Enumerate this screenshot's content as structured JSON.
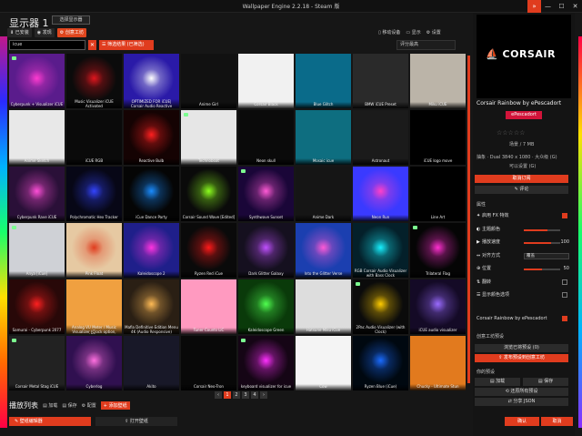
{
  "window": {
    "title": "Wallpaper Engine 2.2.18 - Steam 版"
  },
  "header": {
    "title": "显示器 1",
    "display_select": "选择显示器"
  },
  "tabs": [
    {
      "label": "已安装",
      "icon": "download-icon"
    },
    {
      "label": "发现",
      "icon": "compass-icon"
    },
    {
      "label": "创意工坊",
      "icon": "workshop-icon",
      "active": true
    }
  ],
  "top_right": {
    "mobile": "移动设备",
    "display": "显示",
    "settings": "设置"
  },
  "filter": {
    "search_value": "icue",
    "clear_label": "✕",
    "filter_button": "筛选结果 (已筛选)",
    "sort_value": "评分最高"
  },
  "wallpapers": [
    {
      "title": "Cyberpunk + Visualizer iCUE",
      "bg": "#5a1c8c",
      "fg": "#ff3bd1",
      "badge": true
    },
    {
      "title": "Music Visualizer iCUE Activated",
      "bg": "#0b0b0b",
      "fg": "#e0161e",
      "badge": false
    },
    {
      "title": "OPTIMIZED FOR iCUE| Corsair Audio Reactive",
      "bg": "#2a1aa8",
      "fg": "#ffffff",
      "badge": false
    },
    {
      "title": "Anime Girl",
      "bg": "#111",
      "fg": "#ddd",
      "badge": false
    },
    {
      "title": "Corsair Black",
      "bg": "#f1f1f1",
      "fg": "#000",
      "badge": false
    },
    {
      "title": "Blue Glitch",
      "bg": "#0a6b8a",
      "fg": "#9ff",
      "badge": false
    },
    {
      "title": "BMW iCUE Preset",
      "bg": "#2a2a2a",
      "fg": "#bbb",
      "badge": false
    },
    {
      "title": "Miku iCUE",
      "bg": "#bbb4a8",
      "fg": "#fff",
      "badge": false
    },
    {
      "title": "Anime Sketch",
      "bg": "#e8e8e8",
      "fg": "#333",
      "badge": false
    },
    {
      "title": "iCUE RGB",
      "bg": "#0a0a0a",
      "fg": "#0f0",
      "badge": false
    },
    {
      "title": "Reactive Bulb",
      "bg": "#150303",
      "fg": "#ff2020",
      "badge": false
    },
    {
      "title": "Technoboat",
      "bg": "#e6e6e6",
      "fg": "#222",
      "badge": true
    },
    {
      "title": "Neon skull",
      "bg": "#0a0a0a",
      "fg": "#ddd",
      "badge": false
    },
    {
      "title": "Mosaic icue",
      "bg": "#0e6e80",
      "fg": "#6ff",
      "badge": false
    },
    {
      "title": "Astronaut",
      "bg": "#1b1b1b",
      "fg": "#999",
      "badge": false
    },
    {
      "title": "iCUE logo move",
      "bg": "#000",
      "fg": "#fff",
      "badge": false
    },
    {
      "title": "Cyberpunk Rave iCUE",
      "bg": "#2a1038",
      "fg": "#ff4fd8",
      "badge": false
    },
    {
      "title": "Polychromatic Hex Tracker",
      "bg": "#070716",
      "fg": "#3344ff",
      "badge": false
    },
    {
      "title": "iCue Dance Party",
      "bg": "#050505",
      "fg": "#1a8cff",
      "badge": false
    },
    {
      "title": "Corsair Sound Wave [Edited]",
      "bg": "#0a0a0a",
      "fg": "#8cff1e",
      "badge": false
    },
    {
      "title": "Synthwave Sunset",
      "bg": "#1a0638",
      "fg": "#ff5ad6",
      "badge": true
    },
    {
      "title": "Anime Dark",
      "bg": "#151515",
      "fg": "#eee",
      "badge": false
    },
    {
      "title": "Neon Run",
      "bg": "#3a3aff",
      "fg": "#ff40c8",
      "badge": false
    },
    {
      "title": "Line Art",
      "bg": "#000",
      "fg": "#fff",
      "badge": false
    },
    {
      "title": "Anya [iCue]",
      "bg": "#cfd1d6",
      "fg": "#333",
      "badge": true
    },
    {
      "title": "Pink Float",
      "bg": "#e6c9a2",
      "fg": "#e03c1e",
      "badge": false
    },
    {
      "title": "Kaleidoscope 2",
      "bg": "#1f1f8a",
      "fg": "#ff34e0",
      "badge": false
    },
    {
      "title": "Ryzen Red iCue",
      "bg": "#0a0a0a",
      "fg": "#ff1a1a",
      "badge": false
    },
    {
      "title": "Dark Glitter Galaxy",
      "bg": "#15101f",
      "fg": "#c050ff",
      "badge": false
    },
    {
      "title": "Into the Glitter Verse",
      "bg": "#1b3fb0",
      "fg": "#ff5ad6",
      "badge": false
    },
    {
      "title": "RGB Corsair Audio Visualizer with Bass Clock",
      "bg": "#04202a",
      "fg": "#17f0ff",
      "badge": false
    },
    {
      "title": "Trilateral Flag",
      "bg": "#050505",
      "fg": "#ff2fd0",
      "badge": true
    },
    {
      "title": "Samurai - Cyberpunk 2077",
      "bg": "#280808",
      "fg": "#ff2020",
      "badge": false
    },
    {
      "title": "Analog VU Meter / Music Visualizer (Clock option, LED...",
      "bg": "#f0a040",
      "fg": "#222",
      "badge": false
    },
    {
      "title": "Mafia Definitive Edition Menu 4K (Audio Responsive)",
      "bg": "#2a1f14",
      "fg": "#ffbb55",
      "badge": false
    },
    {
      "title": "Tuner Counts LiC",
      "bg": "#ff9ac0",
      "fg": "#fff",
      "badge": false
    },
    {
      "title": "Kaleidoscope Green",
      "bg": "#0a3a0a",
      "fg": "#4fff4f",
      "badge": false
    },
    {
      "title": "Hatsune Miku iCue",
      "bg": "#ddd",
      "fg": "#6cc",
      "badge": false
    },
    {
      "title": "2Pac Audio Visualizer (with Clock)",
      "bg": "#0b0b0b",
      "fg": "#ffcc00",
      "badge": true
    },
    {
      "title": "iCUE audio visualizer",
      "bg": "#140a26",
      "fg": "#9a6bff",
      "badge": false
    },
    {
      "title": "Corsair Metal Stag iCUE",
      "bg": "#222",
      "fg": "#aaa",
      "badge": true
    },
    {
      "title": "Cyberlog",
      "bg": "#301050",
      "fg": "#ff70e0",
      "badge": false
    },
    {
      "title": "Akito",
      "bg": "#181828",
      "fg": "#ccc",
      "badge": false
    },
    {
      "title": "Corsair Neo-Tron",
      "bg": "#080808",
      "fg": "#fff",
      "badge": false
    },
    {
      "title": "keyboard visualizer for icue",
      "bg": "#150515",
      "fg": "#ff30ff",
      "badge": true
    },
    {
      "title": "Cow",
      "bg": "#f4f4f4",
      "fg": "#111",
      "badge": false
    },
    {
      "title": "Ryzen Blue (iCue)",
      "bg": "#000810",
      "fg": "#1a6bff",
      "badge": false
    },
    {
      "title": "Chucky - Ultimate Stun",
      "bg": "#e27a1e",
      "fg": "#222",
      "badge": false
    }
  ],
  "pager": {
    "pages": [
      "1",
      "2",
      "3",
      "4"
    ],
    "current": "1",
    "prev": "‹",
    "next": "›"
  },
  "playlist": {
    "title": "播放列表",
    "load": "加载",
    "save": "保存",
    "config": "配置",
    "add": "添加壁纸"
  },
  "bottom": {
    "left_button": "壁纸编辑器",
    "mid_button": "打开壁纸"
  },
  "right_panel": {
    "preview_logo": "CORSAIR",
    "title": "Corsair Rainbow by ePescadort",
    "author": "ePescadort",
    "stars": "☆☆☆☆☆",
    "size": "场景 / 7 MB",
    "info": "抽象 · Dual 3840 x 1080 · 大众级 (G)",
    "info2": "可以设置 (G)",
    "unsub": "取消订阅",
    "comment": "评论",
    "properties_label": "属性",
    "props": [
      {
        "label": "启用 FX 特效",
        "type": "check",
        "on": true
      },
      {
        "label": "主题颜色",
        "type": "slider",
        "value": "",
        "fill": 0.65
      },
      {
        "label": "播放速度",
        "type": "slider",
        "value": "100",
        "fill": 0.75
      },
      {
        "label": "对齐方式",
        "type": "dropdown",
        "value": "覆盖"
      },
      {
        "label": "位置",
        "type": "slider",
        "value": "50",
        "fill": 0.5
      },
      {
        "label": "翻转",
        "type": "check",
        "on": false
      },
      {
        "label": "显示颜色选项",
        "type": "check",
        "on": false
      }
    ],
    "preset_name": "Corsair Rainbow by ePescadort",
    "preset_on": true,
    "workshop_label": "创意工坊预设",
    "browse_btn": "浏览已将预设 (0)",
    "share_btn": "发布预设到创意工坊",
    "presets_label": "你的预设",
    "load_btn": "加载",
    "save_btn": "保存",
    "reset_btn": "还原所有预设",
    "json_btn": "分享 JSON",
    "ok": "确认",
    "cancel": "取消"
  }
}
